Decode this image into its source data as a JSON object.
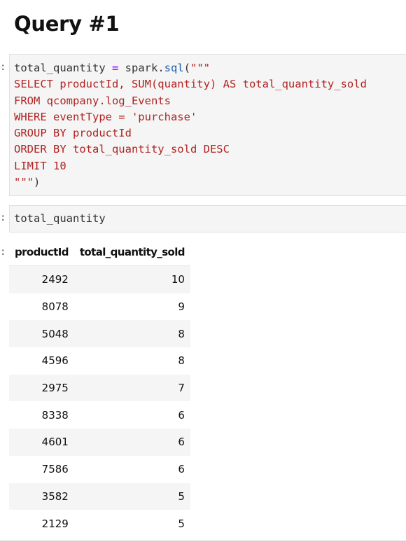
{
  "heading": "Query #1",
  "cells": [
    {
      "prompt": ":",
      "lines": [
        [
          {
            "text": "total_quantity ",
            "cls": ""
          },
          {
            "text": "=",
            "cls": "tok-op"
          },
          {
            "text": " spark.",
            "cls": ""
          },
          {
            "text": "sql",
            "cls": "tok-fn"
          },
          {
            "text": "(",
            "cls": ""
          },
          {
            "text": "\"\"\"",
            "cls": "tok-str"
          }
        ],
        [
          {
            "text": "SELECT productId, SUM(quantity) AS total_quantity_sold",
            "cls": "tok-str"
          }
        ],
        [
          {
            "text": "FROM qcompany.log_Events",
            "cls": "tok-str"
          }
        ],
        [
          {
            "text": "WHERE eventType = 'purchase'",
            "cls": "tok-str"
          }
        ],
        [
          {
            "text": "GROUP BY productId",
            "cls": "tok-str"
          }
        ],
        [
          {
            "text": "ORDER BY total_quantity_sold DESC",
            "cls": "tok-str"
          }
        ],
        [
          {
            "text": "LIMIT 10",
            "cls": "tok-str"
          }
        ],
        [
          {
            "text": "\"\"\"",
            "cls": "tok-str"
          },
          {
            "text": ")",
            "cls": ""
          }
        ]
      ]
    },
    {
      "prompt": ":",
      "lines": [
        [
          {
            "text": "total_quantity",
            "cls": ""
          }
        ]
      ]
    }
  ],
  "output": {
    "prompt": ":",
    "columns": [
      "productId",
      "total_quantity_sold"
    ],
    "rows": [
      [
        "2492",
        "10"
      ],
      [
        "8078",
        "9"
      ],
      [
        "5048",
        "8"
      ],
      [
        "4596",
        "8"
      ],
      [
        "2975",
        "7"
      ],
      [
        "8338",
        "6"
      ],
      [
        "4601",
        "6"
      ],
      [
        "7586",
        "6"
      ],
      [
        "3582",
        "5"
      ],
      [
        "2129",
        "5"
      ]
    ]
  }
}
